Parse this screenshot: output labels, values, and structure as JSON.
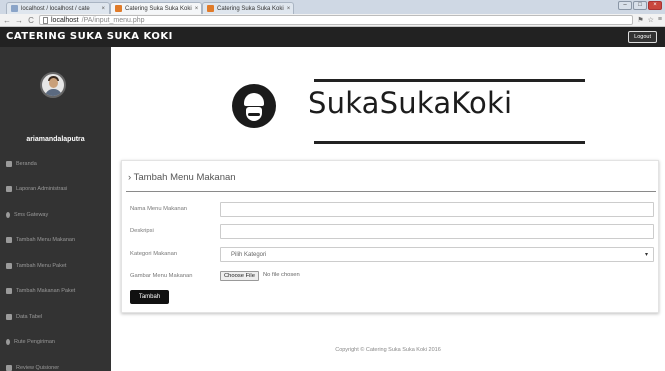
{
  "browser": {
    "tabs": [
      {
        "label": "localhost / localhost / cate"
      },
      {
        "label": "Catering Suka Suka Koki"
      },
      {
        "label": "Catering Suka Suka Koki"
      }
    ],
    "url_host": "localhost",
    "url_path": "/PA/input_menu.php"
  },
  "header": {
    "brand": "CATERING SUKA SUKA KOKI",
    "logout_label": "Logout"
  },
  "sidebar": {
    "username": "ariamandalaputra",
    "items": [
      {
        "label": "Beranda",
        "icon": "home-icon"
      },
      {
        "label": "Laporan Administrasi",
        "icon": "image-icon"
      },
      {
        "label": "Sms Gateway",
        "icon": "phone-icon"
      },
      {
        "label": "Tambah Menu Makanan",
        "icon": "cutlery-icon"
      },
      {
        "label": "Tambah Menu Paket",
        "icon": "list-icon"
      },
      {
        "label": "Tambah Makanan Paket",
        "icon": "cutlery-icon"
      },
      {
        "label": "Data Tabel",
        "icon": "table-icon"
      },
      {
        "label": "Rute Pengiriman",
        "icon": "map-marker-icon"
      },
      {
        "label": "Review Quisioner",
        "icon": "book-icon"
      }
    ]
  },
  "banner": {
    "logo_text": "SukaSukaKoki"
  },
  "form": {
    "title": "› Tambah Menu Makanan",
    "name_label": "Nama Menu Makanan",
    "name_value": "",
    "desc_label": "Deskripsi",
    "desc_value": "",
    "category_label": "Kategori Makanan",
    "category_selected": "Pilih Kategori",
    "image_label": "Gambar Menu Makanan",
    "file_button": "Choose File",
    "file_status": "No file chosen",
    "submit_label": "Tambah"
  },
  "footer": {
    "text": "Copyright © Catering Suka Suka Koki 2016"
  },
  "colors": {
    "header_bg": "#222222",
    "sidebar_bg": "#333333",
    "button_bg": "#111111"
  }
}
